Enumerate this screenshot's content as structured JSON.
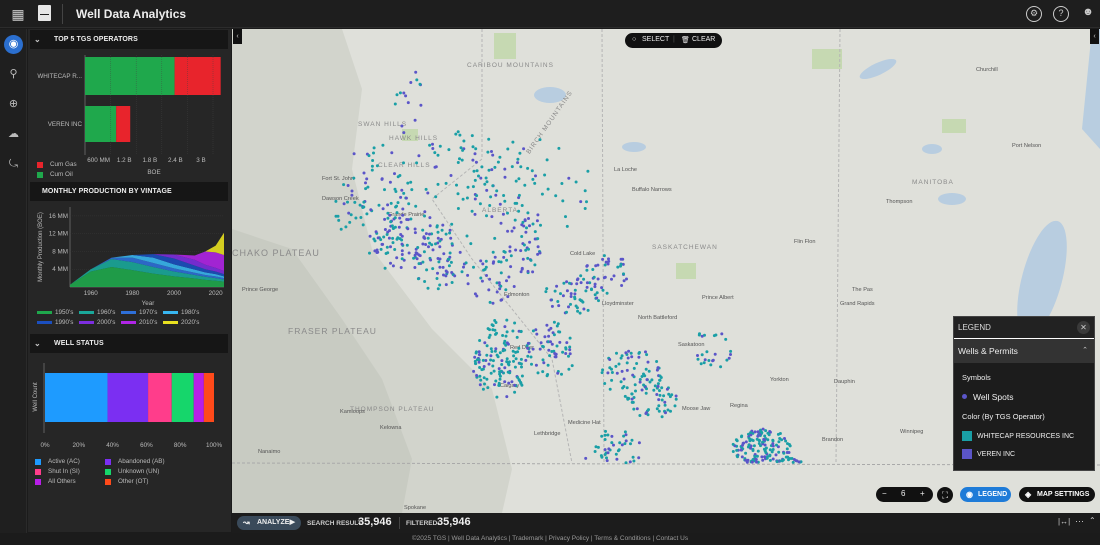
{
  "app": {
    "title": "Well Data Analytics"
  },
  "panel": {
    "operators": {
      "header": "TOP 5 TGS OPERATORS",
      "xlabel": "BOE",
      "ticks": [
        "600 MM",
        "1.2 B",
        "1.8 B",
        "2.4 B",
        "3 B"
      ],
      "legend": [
        {
          "label": "Cum Gas",
          "color": "#e8242c"
        },
        {
          "label": "Cum Oil",
          "color": "#1fa84c"
        }
      ]
    },
    "vintage": {
      "header": "MONTHLY PRODUCTION BY VINTAGE",
      "ylabel": "Monthly Production (BOE)",
      "xlabel": "Year",
      "yticks": [
        "16 MM",
        "12 MM",
        "8 MM",
        "4 MM"
      ],
      "xticks": [
        "1960",
        "1980",
        "2000",
        "2020"
      ],
      "legend": [
        {
          "label": "1950's",
          "color": "#1fa84c"
        },
        {
          "label": "1960's",
          "color": "#1aa89a"
        },
        {
          "label": "1970's",
          "color": "#2e6fd8"
        },
        {
          "label": "1980's",
          "color": "#38b6f0"
        },
        {
          "label": "1990's",
          "color": "#1b4fc0"
        },
        {
          "label": "2000's",
          "color": "#7d2ee0"
        },
        {
          "label": "2010's",
          "color": "#b025e6"
        },
        {
          "label": "2020's",
          "color": "#e8e020"
        }
      ]
    },
    "status": {
      "header": "WELL STATUS",
      "ylabel": "Well Count",
      "xticks": [
        "0%",
        "20%",
        "40%",
        "60%",
        "80%",
        "100%"
      ],
      "legend": [
        {
          "label": "Active (AC)",
          "color": "#1e9bff"
        },
        {
          "label": "Abandoned (AB)",
          "color": "#7b2ff2"
        },
        {
          "label": "Shut In (SI)",
          "color": "#ff3d8b"
        },
        {
          "label": "Unknown (UN)",
          "color": "#16d66b"
        },
        {
          "label": "All Others",
          "color": "#b81ee8"
        },
        {
          "label": "Other (OT)",
          "color": "#ff4a1a"
        }
      ]
    }
  },
  "chart_data": [
    {
      "type": "bar",
      "orientation": "horizontal",
      "stacked": true,
      "title": "TOP 5 TGS OPERATORS",
      "xlabel": "BOE",
      "categories": [
        "WHITECAP R...",
        "VEREN INC"
      ],
      "series": [
        {
          "name": "Cum Oil",
          "values": [
            2100000000,
            730000000
          ]
        },
        {
          "name": "Cum Gas",
          "values": [
            1080000000,
            330000000
          ]
        }
      ],
      "xlim": [
        0,
        3000000000
      ]
    },
    {
      "type": "area",
      "stacked": true,
      "title": "MONTHLY PRODUCTION BY VINTAGE",
      "xlabel": "Year",
      "ylabel": "Monthly Production (BOE)",
      "x": [
        1950,
        1960,
        1970,
        1980,
        1990,
        2000,
        2010,
        2015,
        2020,
        2024
      ],
      "series": [
        {
          "name": "1950's",
          "values": [
            0.5,
            3.5,
            4.5,
            3.8,
            3.0,
            2.4,
            1.9,
            1.6,
            1.4,
            1.2
          ]
        },
        {
          "name": "1960's",
          "values": [
            0,
            0.5,
            1.8,
            1.8,
            1.5,
            1.1,
            0.8,
            0.7,
            0.6,
            0.5
          ]
        },
        {
          "name": "1970's",
          "values": [
            0,
            0,
            0.3,
            1.0,
            0.9,
            0.7,
            0.5,
            0.4,
            0.4,
            0.3
          ]
        },
        {
          "name": "1980's",
          "values": [
            0,
            0,
            0,
            0.6,
            1.2,
            0.9,
            0.7,
            0.6,
            0.5,
            0.4
          ]
        },
        {
          "name": "1990's",
          "values": [
            0,
            0,
            0,
            0,
            0.8,
            1.3,
            0.9,
            0.7,
            0.6,
            0.5
          ]
        },
        {
          "name": "2000's",
          "values": [
            0,
            0,
            0,
            0,
            0,
            0.9,
            1.3,
            1.0,
            0.8,
            0.7
          ]
        },
        {
          "name": "2010's",
          "values": [
            0,
            0,
            0,
            0,
            0,
            0,
            1.0,
            3.0,
            3.5,
            3.6
          ]
        },
        {
          "name": "2020's",
          "values": [
            0,
            0,
            0,
            0,
            0,
            0,
            0,
            0,
            1.5,
            5.0
          ]
        }
      ],
      "ylim": [
        0,
        18
      ]
    },
    {
      "type": "bar",
      "orientation": "horizontal",
      "stacked": true,
      "title": "WELL STATUS",
      "ylabel": "Well Count",
      "categories": [
        ""
      ],
      "series": [
        {
          "name": "Active (AC)",
          "values": [
            37
          ]
        },
        {
          "name": "Abandoned (AB)",
          "values": [
            24
          ]
        },
        {
          "name": "Shut In (SI)",
          "values": [
            14
          ]
        },
        {
          "name": "Unknown (UN)",
          "values": [
            13
          ]
        },
        {
          "name": "All Others",
          "values": [
            6
          ]
        },
        {
          "name": "Other (OT)",
          "values": [
            6
          ]
        }
      ],
      "xlim": [
        0,
        100
      ]
    }
  ],
  "map": {
    "select_label": "SELECT",
    "clear_label": "CLEAR",
    "zoom_level": "6",
    "legend_button": "LEGEND",
    "settings_button": "MAP SETTINGS",
    "regions": [
      "CARIBOU MOUNTAINS",
      "SWAN HILLS",
      "HAWK HILLS",
      "CLEAR HILLS",
      "BIRCH MOUNTAINS",
      "ALBERTA",
      "SASKATCHEWAN",
      "MANITOBA",
      "CHAKO PLATEAU",
      "FRASER PLATEAU",
      "THOMPSON PLATEAU"
    ],
    "cities": [
      "Fort St. John",
      "Dawson Creek",
      "Grande Prairie",
      "Edmonton",
      "Calgary",
      "Lethbridge",
      "Medicine Hat",
      "Red Deer",
      "Lloydminster",
      "Saskatoon",
      "Regina",
      "Moose Jaw",
      "Prince Albert",
      "Brandon",
      "La Loche",
      "Buffalo Narrows",
      "Cold Lake",
      "Flin Flon",
      "The Pas",
      "Thompson",
      "Churchill",
      "Port Nelson",
      "Dauphin",
      "Yorkton",
      "Winnipeg",
      "Grand Rapids",
      "Kelowna",
      "Kamloops",
      "Nanaimo",
      "Prince George",
      "Spokane",
      "North Battleford"
    ]
  },
  "legend": {
    "title": "LEGEND",
    "section": "Wells & Permits",
    "symbols_label": "Symbols",
    "well_spots": "Well Spots",
    "color_by": "Color (By TGS Operator)",
    "items": [
      {
        "label": "WHITECAP RESOURCES INC",
        "color": "#1a9fa6"
      },
      {
        "label": "VEREN INC",
        "color": "#5b55c8"
      }
    ]
  },
  "status_bar": {
    "analyze": "ANALYZE",
    "search_label": "SEARCH RESULT:",
    "search_count": "35,946",
    "filtered_label": "FILTERED:",
    "filtered_count": "35,946"
  },
  "footer": "©2025 TGS | Well Data Analytics | Trademark | Privacy Policy | Terms & Conditions | Contact Us"
}
